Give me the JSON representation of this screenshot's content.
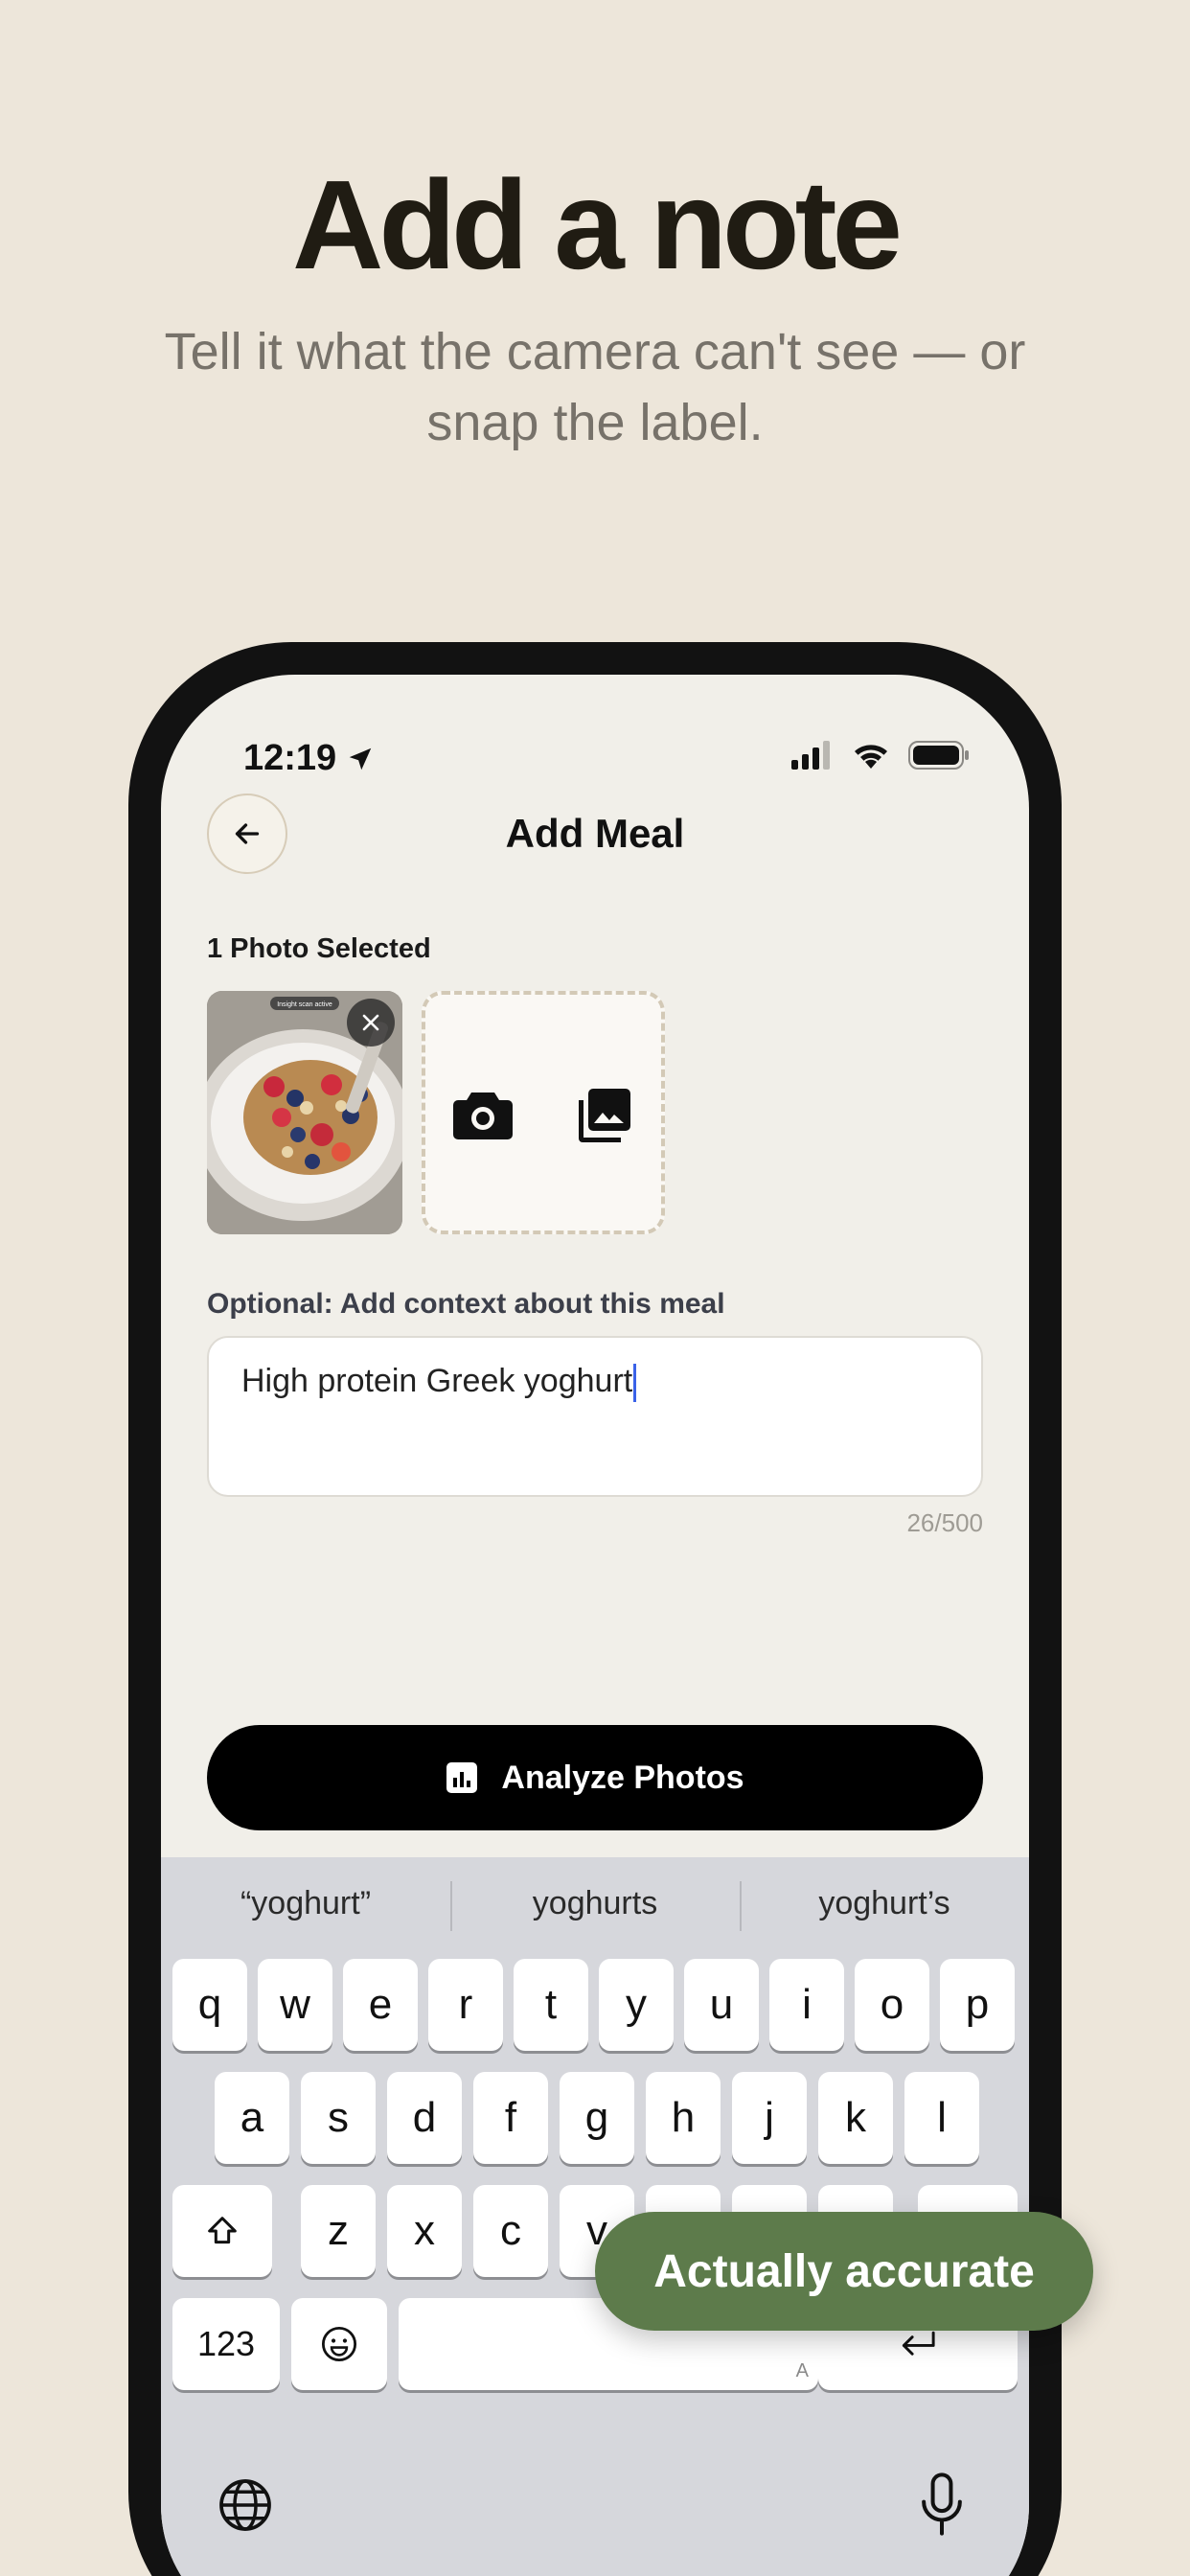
{
  "promo": {
    "headline": "Add a note",
    "subline": "Tell it what the camera can't see — or snap the label."
  },
  "status_bar": {
    "time": "12:19"
  },
  "header": {
    "title": "Add Meal"
  },
  "photos": {
    "label": "1 Photo Selected",
    "thumbnail_caption": "Insight scan active"
  },
  "note": {
    "label": "Optional: Add context about this meal",
    "value": "High protein Greek yoghurt",
    "counter": "26/500"
  },
  "analyze_button": {
    "label": "Analyze Photos"
  },
  "keyboard": {
    "suggestions": [
      "“yoghurt”",
      "yoghurts",
      "yoghurt’s"
    ],
    "row1": [
      "q",
      "w",
      "e",
      "r",
      "t",
      "y",
      "u",
      "i",
      "o",
      "p"
    ],
    "row2": [
      "a",
      "s",
      "d",
      "f",
      "g",
      "h",
      "j",
      "k",
      "l"
    ],
    "row3": [
      "z",
      "x",
      "c",
      "v"
    ],
    "numbers_key": "123",
    "space_hint": "A"
  },
  "toast": {
    "label": "Actually accurate"
  },
  "colors": {
    "background": "#ede6da",
    "toast": "#5d7b4b",
    "button": "#000000",
    "caret": "#3a62e8"
  }
}
